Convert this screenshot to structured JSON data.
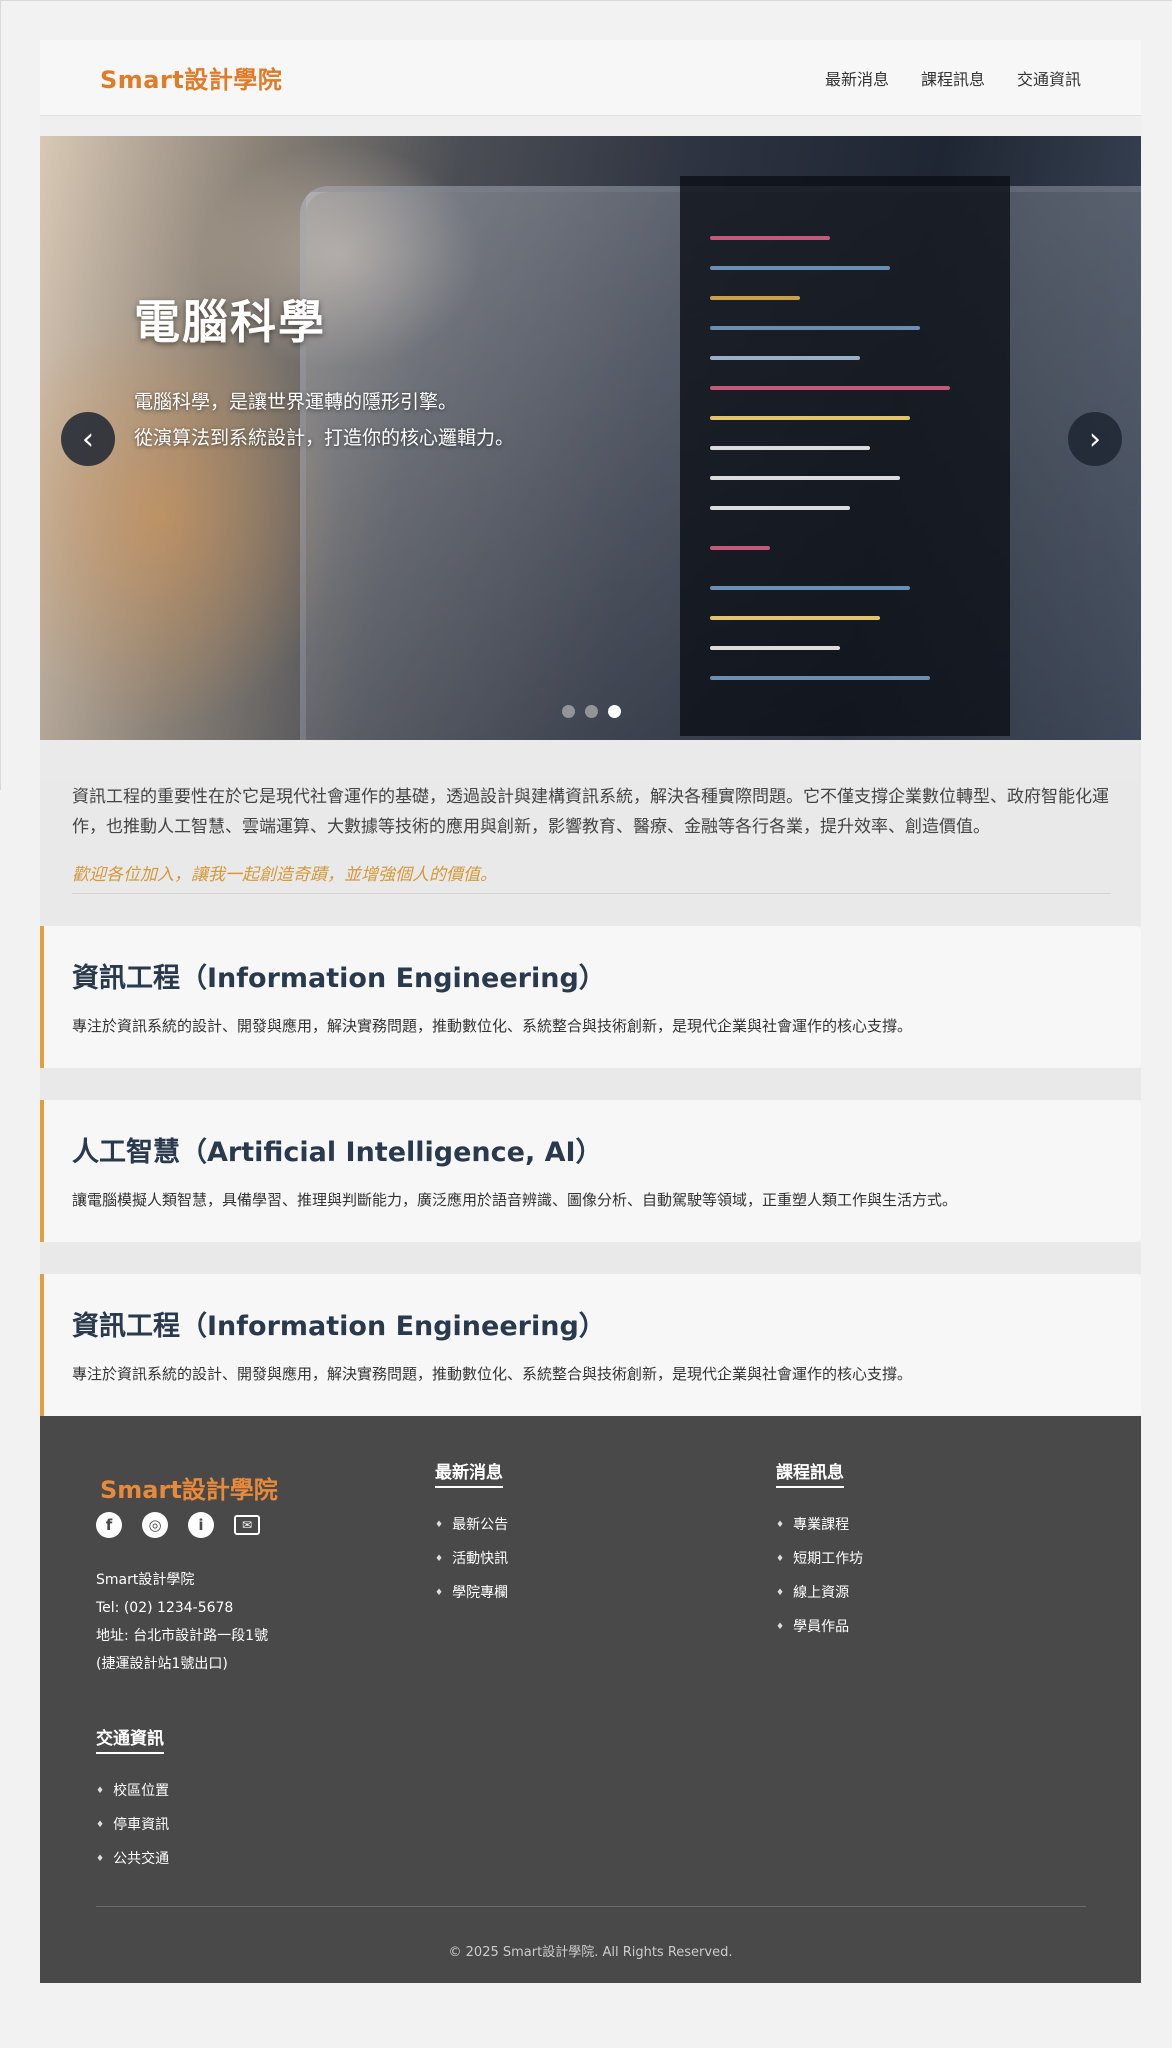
{
  "header": {
    "logo": "Smart設計學院",
    "nav": [
      "最新消息",
      "課程訊息",
      "交通資訊"
    ]
  },
  "hero": {
    "title": "電腦科學",
    "subtitle_line1": "電腦科學，是讓世界運轉的隱形引擎。",
    "subtitle_line2": "從演算法到系統設計，打造你的核心邏輯力。",
    "prev_label": "‹",
    "next_label": "›",
    "slide_count": 3,
    "active_slide": 3
  },
  "intro": {
    "body": "資訊工程的重要性在於它是現代社會運作的基礎，透過設計與建構資訊系統，解決各種實際問題。它不僅支撐企業數位轉型、政府智能化運作，也推動人工智慧、雲端運算、大數據等技術的應用與創新，影響教育、醫療、金融等各行各業，提升效率、創造價值。",
    "tagline": "歡迎各位加入，讓我一起創造奇蹟，並增強個人的價值。"
  },
  "cards": [
    {
      "title": "資訊工程（Information Engineering）",
      "text": "專注於資訊系統的設計、開發與應用，解決實務問題，推動數位化、系統整合與技術創新，是現代企業與社會運作的核心支撐。"
    },
    {
      "title": "人工智慧（Artificial Intelligence, AI）",
      "text": "讓電腦模擬人類智慧，具備學習、推理與判斷能力，廣泛應用於語音辨識、圖像分析、自動駕駛等領域，正重塑人類工作與生活方式。"
    },
    {
      "title": "資訊工程（Information Engineering）",
      "text": "專注於資訊系統的設計、開發與應用，解決實務問題，推動數位化、系統整合與技術創新，是現代企業與社會運作的核心支撐。"
    }
  ],
  "footer": {
    "logo": "Smart設計學院",
    "social_icons": [
      "facebook-icon",
      "instagram-icon",
      "line-icon",
      "mail-icon"
    ],
    "info": [
      "Smart設計學院",
      "Tel: (02) 1234-5678",
      "地址: 台北市設計路一段1號",
      "(捷運設計站1號出口)"
    ],
    "col_news": {
      "title": "最新消息",
      "items": [
        "最新公告",
        "活動快訊",
        "學院專欄"
      ]
    },
    "col_courses": {
      "title": "課程訊息",
      "items": [
        "專業課程",
        "短期工作坊",
        "線上資源",
        "學員作品"
      ]
    },
    "col_traffic": {
      "title": "交通資訊",
      "items": [
        "校區位置",
        "停車資訊",
        "公共交通"
      ]
    },
    "copyright": "© 2025 Smart設計學院. All Rights Reserved."
  }
}
